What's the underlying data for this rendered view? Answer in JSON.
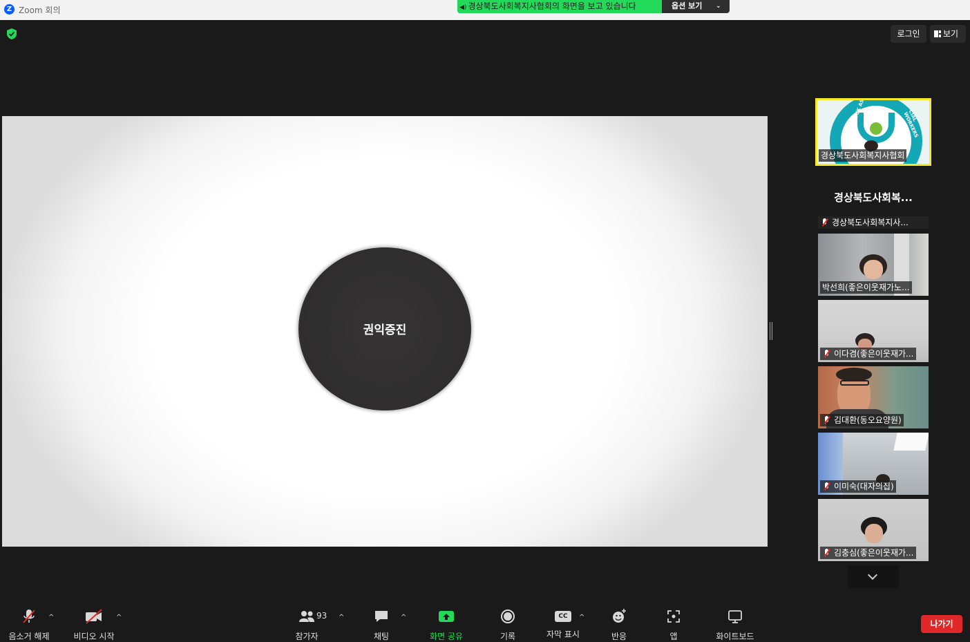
{
  "titlebar": {
    "app_title": "Zoom 회의",
    "app_icon_letter": "Z"
  },
  "share_banner": {
    "message": "경상북도사회복지사협회의 화면을 보고 있습니다",
    "options_label": "옵션 보기"
  },
  "top_right": {
    "login_label": "로그인",
    "view_label": "보기"
  },
  "shared_screen": {
    "slide_text": "권익증진"
  },
  "featured_tile": {
    "name": "경상북도사회복지사협회",
    "logo_text_left": "GYEONGBUK ASS",
    "logo_text_right": "CIAL WORKERS"
  },
  "name_only_tile": {
    "title": "경상북도사회복...",
    "subtitle": "경상북도사회복지사..."
  },
  "participant_tiles": [
    {
      "name": "박선희(좋은이웃재가노...",
      "muted": false
    },
    {
      "name": "이다겸(좋은이웃재가...",
      "muted": true
    },
    {
      "name": "김대환(동오요양원)",
      "muted": true
    },
    {
      "name": "이미숙(대자의집)",
      "muted": true
    },
    {
      "name": "김충심(좋은이웃재가...",
      "muted": true
    }
  ],
  "toolbar": {
    "unmute_label": "음소거 해제",
    "video_label": "비디오 시작",
    "participants_label": "참가자",
    "participants_count": "93",
    "chat_label": "채팅",
    "share_label": "화면 공유",
    "record_label": "기록",
    "captions_label": "자막 표시",
    "captions_badge": "CC",
    "reactions_label": "반응",
    "apps_label": "앱",
    "whiteboard_label": "화이트보드",
    "leave_label": "나가기"
  },
  "colors": {
    "share_green": "#23d959",
    "active_speaker": "#f5e72a",
    "leave_red": "#e02828",
    "muted_red": "#e02828",
    "logo_teal": "#14a8b7"
  },
  "icons": [
    "zoom-logo-icon",
    "speaker-icon",
    "chevron-down-icon",
    "shield-check-icon",
    "grid-view-icon",
    "mic-muted-icon",
    "video-off-icon",
    "caret-up-icon",
    "participants-icon",
    "chat-icon",
    "share-screen-icon",
    "record-icon",
    "cc-icon",
    "reaction-icon",
    "apps-icon",
    "whiteboard-icon"
  ]
}
